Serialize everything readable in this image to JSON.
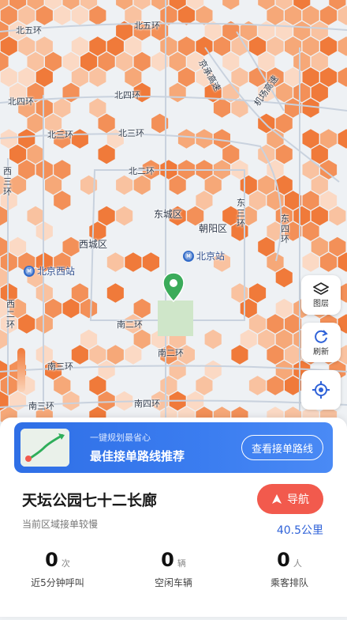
{
  "map": {
    "ring_labels": [
      "北五环",
      "北五环",
      "北四环",
      "北四环",
      "北三环",
      "北三环",
      "北二环",
      "南二环",
      "南二环",
      "南三环",
      "南三环",
      "南四环",
      "西二环",
      "西三环",
      "东三环",
      "东四环",
      "京承高速",
      "机场高速"
    ],
    "district_labels": [
      "东城区",
      "西城区",
      "朝阳区"
    ],
    "stations": [
      "北京西站",
      "北京站"
    ],
    "station_icon": "subway-icon",
    "marker_icon": "location-pin-icon",
    "heat_colors": [
      "#f07a3a",
      "#f39058",
      "#f6a878",
      "#f9c2a0",
      "#fbd9c4"
    ],
    "pin_color": "#3bab5a"
  },
  "side_buttons": [
    {
      "label": "图层",
      "icon": "layers-icon"
    },
    {
      "label": "刷新",
      "icon": "refresh-icon"
    },
    {
      "label": "",
      "icon": "locate-icon"
    }
  ],
  "banner": {
    "small_text": "一键规划最省心",
    "main_text": "最佳接单路线推荐",
    "button_label": "查看接单路线",
    "thumbnail_icon": "route-map-icon"
  },
  "place": {
    "title": "天坛公园七十二长廊",
    "subtitle": "当前区域接单较慢",
    "distance": "40.5公里",
    "nav_label": "导航",
    "nav_icon": "navigation-arrow-icon"
  },
  "stats": [
    {
      "value": "0",
      "unit": "次",
      "label": "近5分钟呼叫"
    },
    {
      "value": "0",
      "unit": "辆",
      "label": "空闲车辆"
    },
    {
      "value": "0",
      "unit": "人",
      "label": "乘客排队"
    }
  ]
}
